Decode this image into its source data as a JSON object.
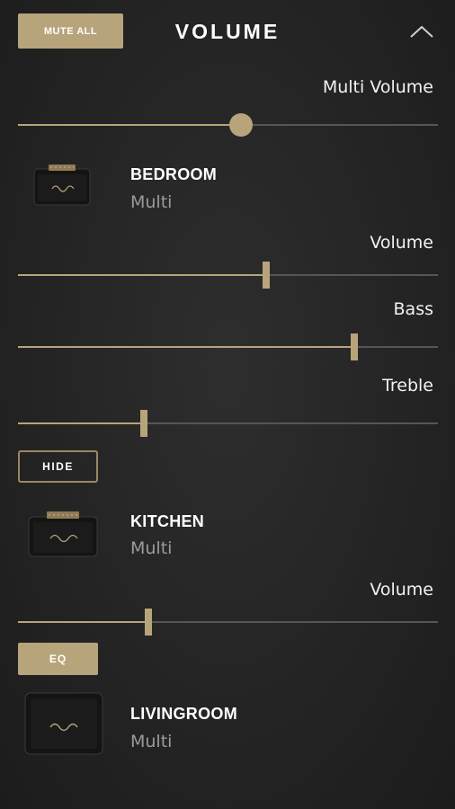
{
  "header": {
    "mute_all_label": "MUTE ALL",
    "title": "VOLUME"
  },
  "multi_volume": {
    "label": "Multi Volume",
    "value": 0.53
  },
  "devices": [
    {
      "name": "BEDROOM",
      "mode": "Multi",
      "volume": {
        "label": "Volume",
        "value": 0.59
      },
      "bass": {
        "label": "Bass",
        "value": 0.8
      },
      "treble": {
        "label": "Treble",
        "value": 0.3
      },
      "toggle_label": "HIDE",
      "speaker_brand": "Marshall"
    },
    {
      "name": "KITCHEN",
      "mode": "Multi",
      "volume": {
        "label": "Volume",
        "value": 0.31
      },
      "toggle_label": "EQ",
      "speaker_brand": "Marshall"
    },
    {
      "name": "LIVINGROOM",
      "mode": "Multi",
      "speaker_brand": "Marshall"
    }
  ],
  "colors": {
    "accent": "#b8a47b",
    "track": "#565656",
    "background": "#262626",
    "secondary_text": "#9b9b9b"
  }
}
